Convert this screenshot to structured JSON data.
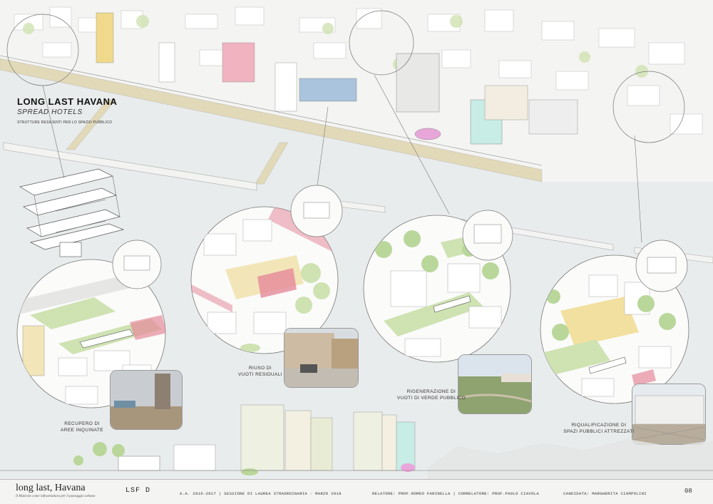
{
  "header": {
    "title": "LONG LAST HAVANA",
    "subtitle": "SPREAD HOTELS",
    "tagline": "STRUTTURE RESILIENTI PER LO SPAZIO PUBBLICO"
  },
  "interventions": [
    {
      "caption_line1": "RECUPERO DI",
      "caption_line2": "AREE INQUINATE"
    },
    {
      "caption_line1": "RIUSO DI",
      "caption_line2": "VUOTI RESIDUALI"
    },
    {
      "caption_line1": "RIGENERAZIONE DI",
      "caption_line2": "VUOTI DI VERDE PUBBLICO"
    },
    {
      "caption_line1": "RIQUALIFICAZIONE DI",
      "caption_line2": "SPAZI PUBBLICI ATTREZZATI"
    }
  ],
  "footer": {
    "title": "long last, Havana",
    "subtitle": "Il Malecón come infrastruttura per il paesaggio urbano",
    "code": "LSF D",
    "session": "A.A. 2016-2017 | SESSIONE DI LAUREA STRAORDINARIA - MARZO 2018",
    "advisors": "RELATORE: PROF.ROMEO FARINELLA | CORRELATORE: PROF.PAOLO CIAVOLA",
    "candidate": "CANDIDATA: MARGHERITA CIAMPOLINI",
    "page": "08"
  },
  "colors": {
    "sea": "#e9ecec",
    "promenade": "#e2d9b8",
    "green": "#cfe2b2",
    "accent_pink": "#e58a9a",
    "accent_yellow": "#f0d98a"
  }
}
